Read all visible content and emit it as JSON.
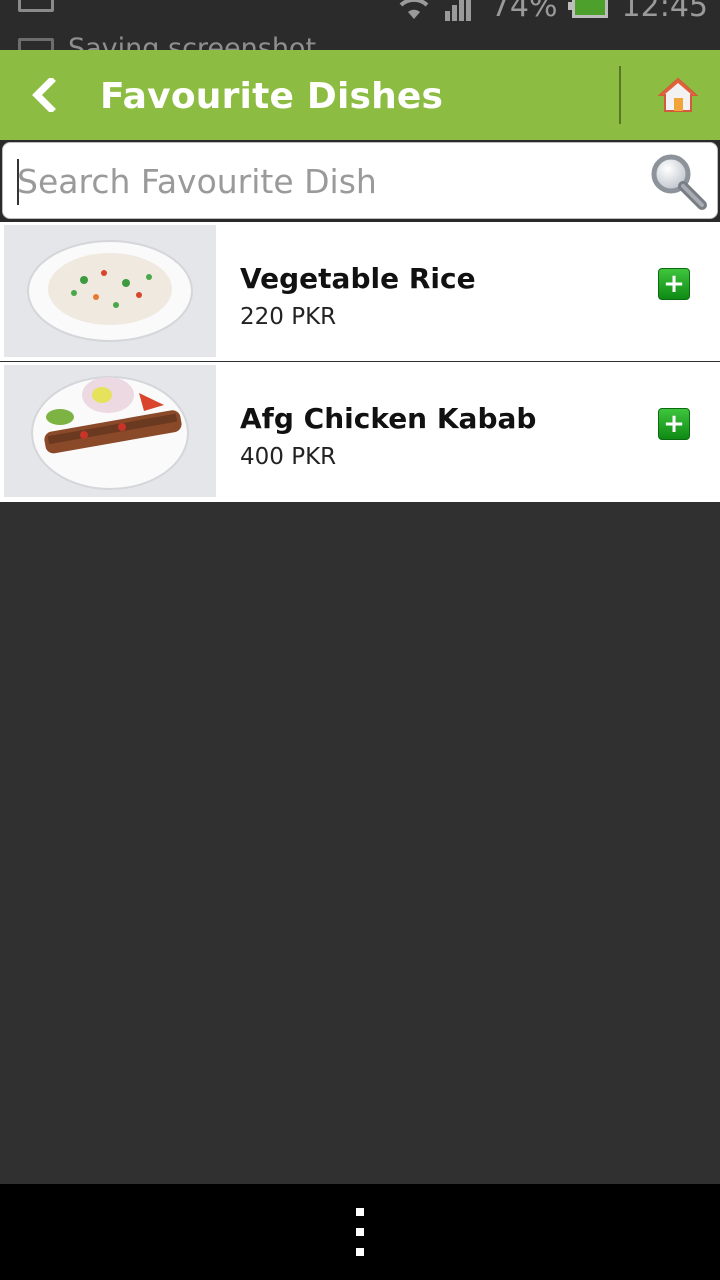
{
  "status_bar": {
    "ticker": "Saving screenshot",
    "battery": "74%",
    "time": "12:45"
  },
  "app_bar": {
    "title": "Favourite Dishes",
    "back_icon": "back-chevron-icon",
    "home_icon": "home-icon",
    "color": "#8cbd42"
  },
  "search": {
    "placeholder": "Search Favourite Dish",
    "value": "",
    "icon": "magnifier-icon"
  },
  "dishes": [
    {
      "name": "Vegetable Rice",
      "price": "220 PKR",
      "add_label": "+"
    },
    {
      "name": "Afg Chicken Kabab",
      "price": "400 PKR",
      "add_label": "+"
    }
  ],
  "nav_bar": {
    "menu_icon": "overflow-menu-icon"
  }
}
